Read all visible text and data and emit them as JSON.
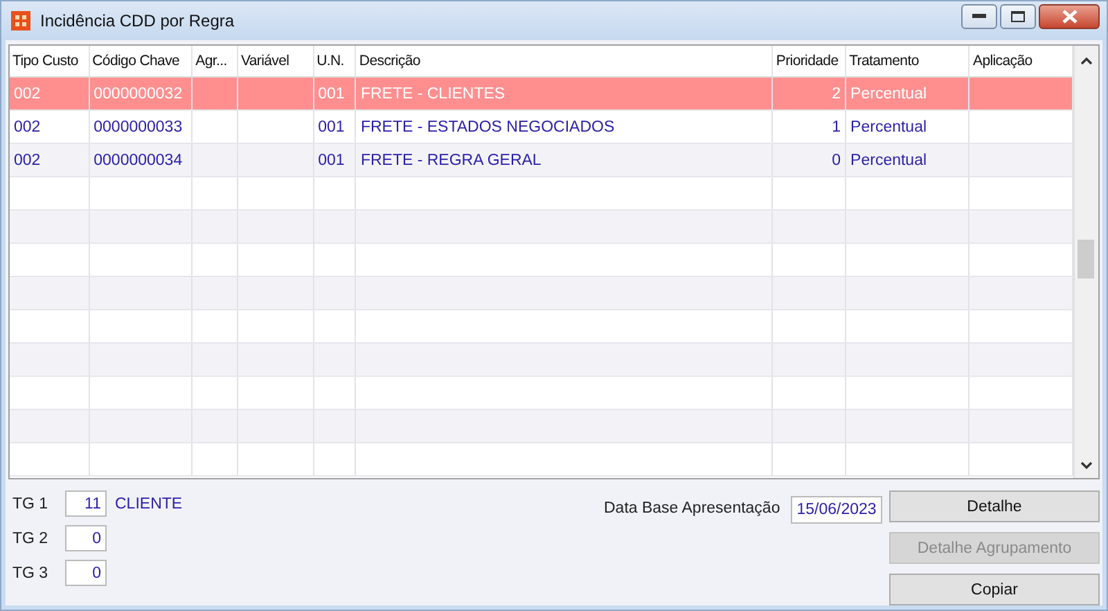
{
  "window": {
    "title": "Incidência CDD por Regra"
  },
  "table": {
    "columns": [
      "Tipo Custo",
      "Código Chave",
      "Agr...",
      "Variável",
      "U.N.",
      "Descrição",
      "Prioridade",
      "Tratamento",
      "Aplicação"
    ],
    "rows": [
      {
        "selected": true,
        "cells": [
          "002",
          "0000000032",
          "",
          "",
          "001",
          "FRETE - CLIENTES",
          "2",
          "Percentual",
          ""
        ]
      },
      {
        "selected": false,
        "cells": [
          "002",
          "0000000033",
          "",
          "",
          "001",
          "FRETE - ESTADOS NEGOCIADOS",
          "1",
          "Percentual",
          ""
        ]
      },
      {
        "selected": false,
        "cells": [
          "002",
          "0000000034",
          "",
          "",
          "001",
          "FRETE - REGRA GERAL",
          "0",
          "Percentual",
          ""
        ]
      }
    ]
  },
  "groups": [
    {
      "label": "TG 1",
      "value": "11",
      "description": "CLIENTE"
    },
    {
      "label": "TG 2",
      "value": "0"
    },
    {
      "label": "TG 3",
      "value": "0"
    }
  ],
  "date_field": {
    "label": "Data Base Apresentação",
    "value": "15/06/2023"
  },
  "buttons": [
    {
      "label": "Detalhe",
      "disabled": false
    },
    {
      "label": "Detalhe Agrupamento",
      "disabled": true
    },
    {
      "label": "Copiar",
      "disabled": false
    }
  ]
}
